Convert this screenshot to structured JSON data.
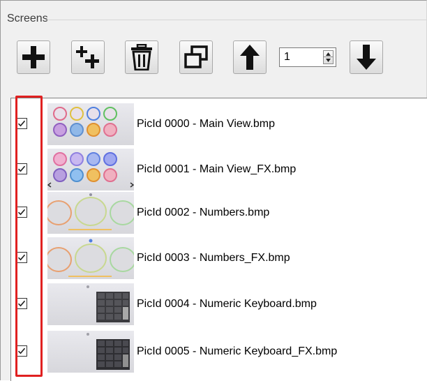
{
  "group": {
    "title": "Screens"
  },
  "toolbar": {
    "add_icon": "plus-icon",
    "add_multiple_icon": "add-multiple-icon",
    "delete_icon": "trash-icon",
    "duplicate_icon": "duplicate-icon",
    "move_up_icon": "arrow-up-icon",
    "move_down_icon": "arrow-down-icon",
    "step_value": "1"
  },
  "screens": [
    {
      "label": "PicId 0000 - Main View.bmp",
      "checked": true,
      "thumb": "buttons"
    },
    {
      "label": "PicId 0001 - Main View_FX.bmp",
      "checked": true,
      "thumb": "buttons-fx"
    },
    {
      "label": "PicId 0002 - Numbers.bmp",
      "checked": true,
      "thumb": "dials"
    },
    {
      "label": "PicId 0003 - Numbers_FX.bmp",
      "checked": true,
      "thumb": "dials-fx"
    },
    {
      "label": "PicId 0004 - Numeric Keyboard.bmp",
      "checked": true,
      "thumb": "keypad"
    },
    {
      "label": "PicId 0005 - Numeric Keyboard_FX.bmp",
      "checked": true,
      "thumb": "keypad-fx"
    }
  ],
  "colors": {
    "highlight": "#e02020",
    "panel": "#f0f0f0"
  }
}
